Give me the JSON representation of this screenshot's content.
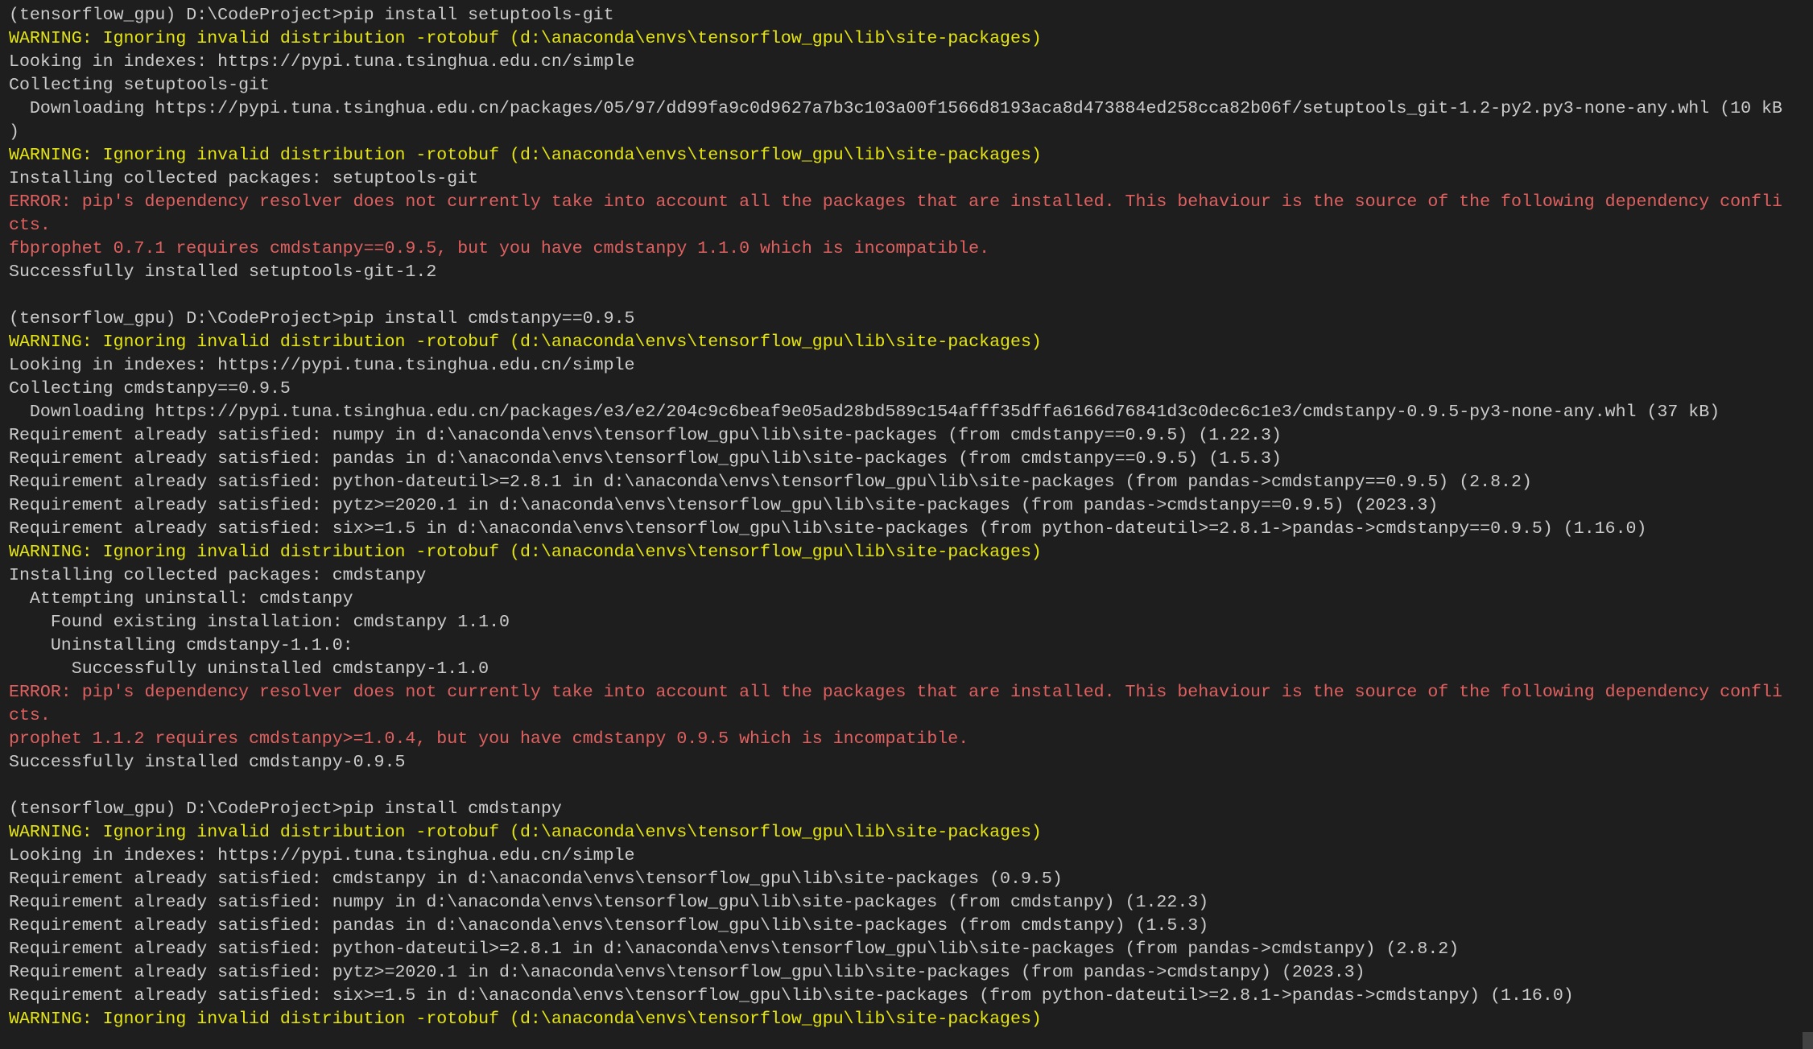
{
  "colors": {
    "background": "#1e1e1e",
    "text": "#cccccc",
    "warning": "#e5e510",
    "error": "#e06060"
  },
  "lines": [
    {
      "type": "prompt",
      "text": "(tensorflow_gpu) D:\\CodeProject>pip install setuptools-git"
    },
    {
      "type": "warn",
      "text": "WARNING: Ignoring invalid distribution -rotobuf (d:\\anaconda\\envs\\tensorflow_gpu\\lib\\site-packages)"
    },
    {
      "type": "out",
      "text": "Looking in indexes: https://pypi.tuna.tsinghua.edu.cn/simple"
    },
    {
      "type": "out",
      "text": "Collecting setuptools-git"
    },
    {
      "type": "out",
      "text": "  Downloading https://pypi.tuna.tsinghua.edu.cn/packages/05/97/dd99fa9c0d9627a7b3c103a00f1566d8193aca8d473884ed258cca82b06f/setuptools_git-1.2-py2.py3-none-any.whl (10 kB"
    },
    {
      "type": "out",
      "text": ")"
    },
    {
      "type": "warn",
      "text": "WARNING: Ignoring invalid distribution -rotobuf (d:\\anaconda\\envs\\tensorflow_gpu\\lib\\site-packages)"
    },
    {
      "type": "out",
      "text": "Installing collected packages: setuptools-git"
    },
    {
      "type": "err",
      "text": "ERROR: pip's dependency resolver does not currently take into account all the packages that are installed. This behaviour is the source of the following dependency confli"
    },
    {
      "type": "err",
      "text": "cts."
    },
    {
      "type": "err",
      "text": "fbprophet 0.7.1 requires cmdstanpy==0.9.5, but you have cmdstanpy 1.1.0 which is incompatible."
    },
    {
      "type": "out",
      "text": "Successfully installed setuptools-git-1.2"
    },
    {
      "type": "out",
      "text": ""
    },
    {
      "type": "prompt",
      "text": "(tensorflow_gpu) D:\\CodeProject>pip install cmdstanpy==0.9.5"
    },
    {
      "type": "warn",
      "text": "WARNING: Ignoring invalid distribution -rotobuf (d:\\anaconda\\envs\\tensorflow_gpu\\lib\\site-packages)"
    },
    {
      "type": "out",
      "text": "Looking in indexes: https://pypi.tuna.tsinghua.edu.cn/simple"
    },
    {
      "type": "out",
      "text": "Collecting cmdstanpy==0.9.5"
    },
    {
      "type": "out",
      "text": "  Downloading https://pypi.tuna.tsinghua.edu.cn/packages/e3/e2/204c9c6beaf9e05ad28bd589c154afff35dffa6166d76841d3c0dec6c1e3/cmdstanpy-0.9.5-py3-none-any.whl (37 kB)"
    },
    {
      "type": "out",
      "text": "Requirement already satisfied: numpy in d:\\anaconda\\envs\\tensorflow_gpu\\lib\\site-packages (from cmdstanpy==0.9.5) (1.22.3)"
    },
    {
      "type": "out",
      "text": "Requirement already satisfied: pandas in d:\\anaconda\\envs\\tensorflow_gpu\\lib\\site-packages (from cmdstanpy==0.9.5) (1.5.3)"
    },
    {
      "type": "out",
      "text": "Requirement already satisfied: python-dateutil>=2.8.1 in d:\\anaconda\\envs\\tensorflow_gpu\\lib\\site-packages (from pandas->cmdstanpy==0.9.5) (2.8.2)"
    },
    {
      "type": "out",
      "text": "Requirement already satisfied: pytz>=2020.1 in d:\\anaconda\\envs\\tensorflow_gpu\\lib\\site-packages (from pandas->cmdstanpy==0.9.5) (2023.3)"
    },
    {
      "type": "out",
      "text": "Requirement already satisfied: six>=1.5 in d:\\anaconda\\envs\\tensorflow_gpu\\lib\\site-packages (from python-dateutil>=2.8.1->pandas->cmdstanpy==0.9.5) (1.16.0)"
    },
    {
      "type": "warn",
      "text": "WARNING: Ignoring invalid distribution -rotobuf (d:\\anaconda\\envs\\tensorflow_gpu\\lib\\site-packages)"
    },
    {
      "type": "out",
      "text": "Installing collected packages: cmdstanpy"
    },
    {
      "type": "out",
      "text": "  Attempting uninstall: cmdstanpy"
    },
    {
      "type": "out",
      "text": "    Found existing installation: cmdstanpy 1.1.0"
    },
    {
      "type": "out",
      "text": "    Uninstalling cmdstanpy-1.1.0:"
    },
    {
      "type": "out",
      "text": "      Successfully uninstalled cmdstanpy-1.1.0"
    },
    {
      "type": "err",
      "text": "ERROR: pip's dependency resolver does not currently take into account all the packages that are installed. This behaviour is the source of the following dependency confli"
    },
    {
      "type": "err",
      "text": "cts."
    },
    {
      "type": "err",
      "text": "prophet 1.1.2 requires cmdstanpy>=1.0.4, but you have cmdstanpy 0.9.5 which is incompatible."
    },
    {
      "type": "out",
      "text": "Successfully installed cmdstanpy-0.9.5"
    },
    {
      "type": "out",
      "text": ""
    },
    {
      "type": "prompt",
      "text": "(tensorflow_gpu) D:\\CodeProject>pip install cmdstanpy"
    },
    {
      "type": "warn",
      "text": "WARNING: Ignoring invalid distribution -rotobuf (d:\\anaconda\\envs\\tensorflow_gpu\\lib\\site-packages)"
    },
    {
      "type": "out",
      "text": "Looking in indexes: https://pypi.tuna.tsinghua.edu.cn/simple"
    },
    {
      "type": "out",
      "text": "Requirement already satisfied: cmdstanpy in d:\\anaconda\\envs\\tensorflow_gpu\\lib\\site-packages (0.9.5)"
    },
    {
      "type": "out",
      "text": "Requirement already satisfied: numpy in d:\\anaconda\\envs\\tensorflow_gpu\\lib\\site-packages (from cmdstanpy) (1.22.3)"
    },
    {
      "type": "out",
      "text": "Requirement already satisfied: pandas in d:\\anaconda\\envs\\tensorflow_gpu\\lib\\site-packages (from cmdstanpy) (1.5.3)"
    },
    {
      "type": "out",
      "text": "Requirement already satisfied: python-dateutil>=2.8.1 in d:\\anaconda\\envs\\tensorflow_gpu\\lib\\site-packages (from pandas->cmdstanpy) (2.8.2)"
    },
    {
      "type": "out",
      "text": "Requirement already satisfied: pytz>=2020.1 in d:\\anaconda\\envs\\tensorflow_gpu\\lib\\site-packages (from pandas->cmdstanpy) (2023.3)"
    },
    {
      "type": "out",
      "text": "Requirement already satisfied: six>=1.5 in d:\\anaconda\\envs\\tensorflow_gpu\\lib\\site-packages (from python-dateutil>=2.8.1->pandas->cmdstanpy) (1.16.0)"
    },
    {
      "type": "warn",
      "text": "WARNING: Ignoring invalid distribution -rotobuf (d:\\anaconda\\envs\\tensorflow_gpu\\lib\\site-packages)"
    }
  ]
}
